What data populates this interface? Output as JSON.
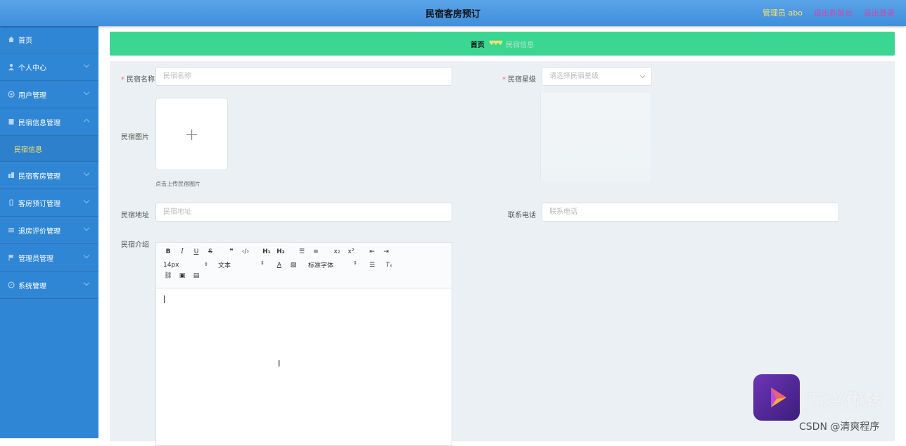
{
  "header": {
    "title": "民宿客房预订",
    "admin_label": "管理员 abo",
    "front_link": "退出到前台",
    "logout_link": "退出登录"
  },
  "sidebar": {
    "items": [
      {
        "label": "首页",
        "icon": "home-icon"
      },
      {
        "label": "个人中心",
        "icon": "user-icon"
      },
      {
        "label": "用户管理",
        "icon": "users-icon"
      },
      {
        "label": "民宿信息管理",
        "icon": "document-icon"
      },
      {
        "label": "民宿客房管理",
        "icon": "building-icon"
      },
      {
        "label": "客房预订管理",
        "icon": "phone-icon"
      },
      {
        "label": "退房评价管理",
        "icon": "list-icon"
      },
      {
        "label": "管理员管理",
        "icon": "flag-icon"
      },
      {
        "label": "系统管理",
        "icon": "compass-icon"
      }
    ],
    "submenu": {
      "label": "民宿信息"
    }
  },
  "breadcrumb": {
    "home": "首页",
    "separator": "♥♥♥",
    "current": "民宿信息"
  },
  "form": {
    "name_label": "民宿名称",
    "name_placeholder": "民宿名称",
    "star_label": "民宿星级",
    "star_placeholder": "请选择民宿星级",
    "image_label": "民宿图片",
    "upload_tip": "点击上传民宿图片",
    "address_label": "民宿地址",
    "address_placeholder": "民宿地址",
    "phone_label": "联系电话",
    "phone_placeholder": "联系电话",
    "intro_label": "民宿介绍"
  },
  "editor": {
    "font_size": "14px",
    "text_type": "文本",
    "font_family": "标准字体"
  },
  "watermark": {
    "brand": "万兴优转",
    "credit": "CSDN @清爽程序"
  }
}
